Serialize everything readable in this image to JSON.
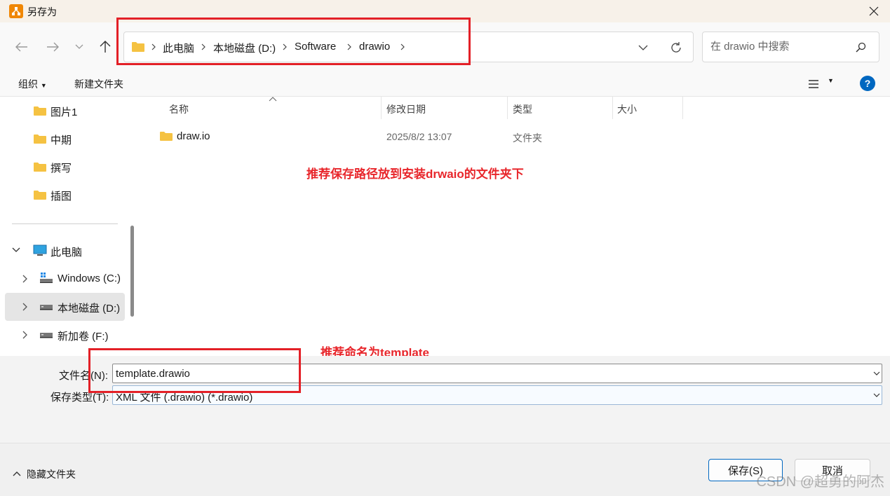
{
  "window": {
    "title": "另存为"
  },
  "breadcrumbs": [
    "此电脑",
    "本地磁盘 (D:)",
    "Software",
    "drawio"
  ],
  "search": {
    "placeholder": "在 drawio 中搜索"
  },
  "commands": {
    "organize": "组织",
    "new_folder": "新建文件夹"
  },
  "nav_pane": {
    "quick_items": [
      "图片1",
      "中期",
      "撰写",
      "插图"
    ],
    "this_pc": "此电脑",
    "drives": [
      "Windows (C:)",
      "本地磁盘 (D:)",
      "新加卷 (F:)"
    ]
  },
  "columns": {
    "name": "名称",
    "modified": "修改日期",
    "type": "类型",
    "size": "大小"
  },
  "files": [
    {
      "name": "draw.io",
      "modified": "2025/8/2 13:07",
      "type": "文件夹"
    }
  ],
  "annotations": {
    "path_note": "推荐保存路径放到安装drwaio的文件夹下",
    "name_note": "推荐命名为template"
  },
  "fields": {
    "filename_label": "文件名(N):",
    "filename_value": "template.drawio",
    "filetype_label": "保存类型(T):",
    "filetype_value": "XML 文件 (.drawio) (*.drawio)"
  },
  "footer": {
    "hide_folders": "隐藏文件夹",
    "save": "保存(S)",
    "cancel": "取消"
  },
  "watermark": "CSDN @超勇的阿杰",
  "colors": {
    "annotation": "#e8262b",
    "accent": "#0067c0",
    "folder": "#f5c242"
  }
}
